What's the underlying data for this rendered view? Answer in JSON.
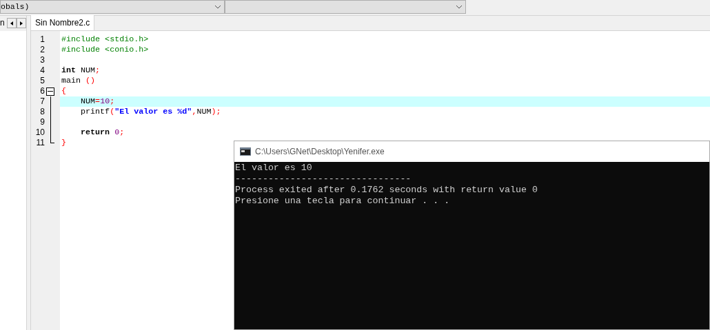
{
  "toolbar": {
    "dropdowns": [
      {
        "value": "obals)"
      }
    ]
  },
  "side_panel": {
    "tab_label": "n"
  },
  "editor_tabs": [
    {
      "label": "Sin Nombre2.c",
      "selected": true
    }
  ],
  "code_lines": [
    {
      "number": "1",
      "highlighted": false,
      "fold_start": false,
      "in_fold": false,
      "fold_end": false,
      "tokens": [
        {
          "kind": "preprocessor",
          "text": "#include <stdio.h>"
        }
      ]
    },
    {
      "number": "2",
      "highlighted": false,
      "fold_start": false,
      "in_fold": false,
      "fold_end": false,
      "tokens": [
        {
          "kind": "preprocessor",
          "text": "#include <conio.h>"
        }
      ]
    },
    {
      "number": "3",
      "highlighted": false,
      "fold_start": false,
      "in_fold": false,
      "fold_end": false
    },
    {
      "number": "4",
      "highlighted": false,
      "fold_start": false,
      "in_fold": false,
      "fold_end": false,
      "tokens": [
        {
          "kind": "keyword",
          "text": "int"
        },
        {
          "kind": "ident",
          "text": " NUM"
        },
        {
          "kind": "symbol",
          "text": ";"
        }
      ]
    },
    {
      "number": "5",
      "highlighted": false,
      "fold_start": false,
      "in_fold": false,
      "fold_end": false,
      "tokens": [
        {
          "kind": "ident",
          "text": "main "
        },
        {
          "kind": "symbol",
          "text": "()"
        }
      ]
    },
    {
      "number": "6",
      "highlighted": false,
      "fold_start": true,
      "in_fold": false,
      "fold_end": false,
      "tokens": [
        {
          "kind": "symbol",
          "text": "{"
        }
      ]
    },
    {
      "number": "7",
      "highlighted": true,
      "fold_start": false,
      "in_fold": true,
      "fold_end": false,
      "tokens": [
        {
          "kind": "ident",
          "text": "    NUM"
        },
        {
          "kind": "symbol",
          "text": "="
        },
        {
          "kind": "number",
          "text": "10"
        },
        {
          "kind": "symbol",
          "text": ";"
        }
      ]
    },
    {
      "number": "8",
      "highlighted": false,
      "fold_start": false,
      "in_fold": true,
      "fold_end": false,
      "tokens": [
        {
          "kind": "ident",
          "text": "    printf"
        },
        {
          "kind": "symbol",
          "text": "("
        },
        {
          "kind": "string",
          "text": "\"El valor es %d\""
        },
        {
          "kind": "symbol",
          "text": ","
        },
        {
          "kind": "ident",
          "text": "NUM"
        },
        {
          "kind": "symbol",
          "text": ");"
        }
      ]
    },
    {
      "number": "9",
      "highlighted": false,
      "fold_start": false,
      "in_fold": true,
      "fold_end": false
    },
    {
      "number": "10",
      "highlighted": false,
      "fold_start": false,
      "in_fold": true,
      "fold_end": false,
      "tokens": [
        {
          "kind": "keyword",
          "text": "    return"
        },
        {
          "kind": "number",
          "text": " 0"
        },
        {
          "kind": "symbol",
          "text": ";"
        }
      ]
    },
    {
      "number": "11",
      "highlighted": false,
      "fold_start": false,
      "in_fold": false,
      "fold_end": true,
      "tokens": [
        {
          "kind": "symbol",
          "text": "}"
        }
      ]
    }
  ],
  "console": {
    "title": "C:\\Users\\GNet\\Desktop\\Yenifer.exe",
    "lines": [
      "El valor es 10",
      "--------------------------------",
      "Process exited after 0.1762 seconds with return value 0",
      "Presione una tecla para continuar . . ."
    ]
  }
}
